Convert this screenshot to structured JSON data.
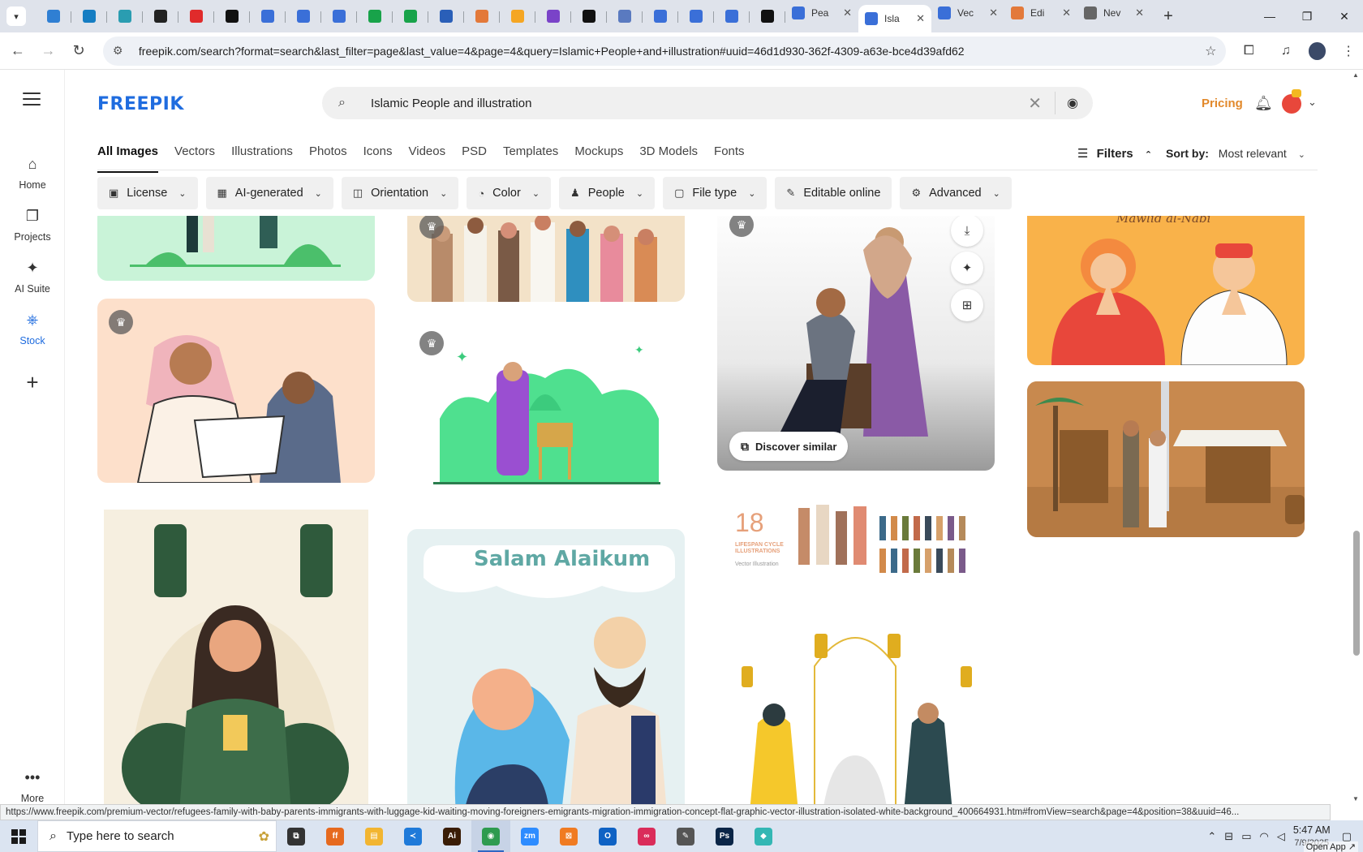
{
  "browser": {
    "tabs": [
      {
        "label": "Pea",
        "color": "#3a6fd8",
        "active": false
      },
      {
        "label": "Isla",
        "color": "#3a6fd8",
        "active": true
      },
      {
        "label": "Vec",
        "color": "#3a6fd8",
        "active": false
      },
      {
        "label": "Edi",
        "color": "#e3793a",
        "active": false
      },
      {
        "label": "Nev",
        "color": "#666666",
        "active": false
      }
    ],
    "pinned_colors": [
      "#2f7fd3",
      "#157dc2",
      "#2a9db1",
      "#222222",
      "#e02b2b",
      "#111111",
      "#3a6fd8",
      "#3a6fd8",
      "#3a6fd8",
      "#18a34a",
      "#18a34a",
      "#2a5fb8",
      "#e3793a",
      "#f5a623",
      "#7a43c8",
      "#111111",
      "#5a7ac0",
      "#3a6fd8",
      "#3a6fd8",
      "#3a6fd8",
      "#111111"
    ],
    "url": "freepik.com/search?format=search&last_filter=page&last_value=4&page=4&query=Islamic+People+and+illustration#uuid=46d1d930-362f-4309-a63e-bce4d39afd62",
    "new_tab": "+",
    "close_x": "✕"
  },
  "rail": {
    "items": [
      {
        "label": "Home",
        "icon": "⌂"
      },
      {
        "label": "Projects",
        "icon": "❐"
      },
      {
        "label": "AI Suite",
        "icon": "✦"
      },
      {
        "label": "Stock",
        "icon": "⎈"
      }
    ],
    "plus": "+",
    "more_label": "More",
    "more_icon": "•••"
  },
  "header": {
    "logo": "FREEPIK",
    "search_value": "Islamic People and illustration",
    "pricing": "Pricing"
  },
  "category_tabs": [
    "All Images",
    "Vectors",
    "Illustrations",
    "Photos",
    "Icons",
    "Videos",
    "PSD",
    "Templates",
    "Mockups",
    "3D Models",
    "Fonts"
  ],
  "filters_label": "Filters",
  "sort": {
    "label": "Sort by:",
    "value": "Most relevant"
  },
  "chips": [
    {
      "label": "License",
      "icon": "▣"
    },
    {
      "label": "AI-generated",
      "icon": "▦"
    },
    {
      "label": "Orientation",
      "icon": "◫"
    },
    {
      "label": "Color",
      "icon": "◔"
    },
    {
      "label": "People",
      "icon": "♟"
    },
    {
      "label": "File type",
      "icon": "▢"
    },
    {
      "label": "Editable online",
      "icon": "✎"
    },
    {
      "label": "Advanced",
      "icon": "⚙"
    }
  ],
  "cards": {
    "salam_title": "Salam Alaikum",
    "mawlid_title": "Mawlid al-Nabi",
    "lifespan_number": "18",
    "lifespan_caption": "LIFESPAN CYCLE ILLUSTRATIONS",
    "lifespan_sub": "Vector Illustration",
    "discover_label": "Discover similar"
  },
  "status_url": "https://www.freepik.com/premium-vector/refugees-family-with-baby-parents-immigrants-with-luggage-kid-waiting-moving-foreigners-emigrants-migration-immigration-concept-flat-graphic-vector-illustration-isolated-white-background_400664931.htm#fromView=search&page=4&position=38&uuid=46...",
  "taskbar": {
    "search_placeholder": "Type here to search",
    "apps": [
      {
        "name": "task-view",
        "color": "#333333",
        "glyph": "⧉"
      },
      {
        "name": "firefox",
        "color": "#e66a1f",
        "glyph": "ff"
      },
      {
        "name": "file-explorer",
        "color": "#f2b531",
        "glyph": "▤"
      },
      {
        "name": "vscode",
        "color": "#1f7ad9",
        "glyph": "≺"
      },
      {
        "name": "illustrator",
        "color": "#3a1d06",
        "glyph": "Ai"
      },
      {
        "name": "chrome",
        "color": "#2e9b4f",
        "glyph": "◉"
      },
      {
        "name": "zoom",
        "color": "#2d8cff",
        "glyph": "zm"
      },
      {
        "name": "xampp",
        "color": "#f07b22",
        "glyph": "⊠"
      },
      {
        "name": "outlook",
        "color": "#0f62c4",
        "glyph": "O"
      },
      {
        "name": "creative-cloud",
        "color": "#da2c5a",
        "glyph": "∞"
      },
      {
        "name": "pen-tool",
        "color": "#555555",
        "glyph": "✎"
      },
      {
        "name": "photoshop",
        "color": "#0a2547",
        "glyph": "Ps"
      },
      {
        "name": "app-generic",
        "color": "#33b7b4",
        "glyph": "◆"
      }
    ],
    "time": "5:47 AM",
    "date": "7/9/2025",
    "open_app": "Open App ↗"
  }
}
